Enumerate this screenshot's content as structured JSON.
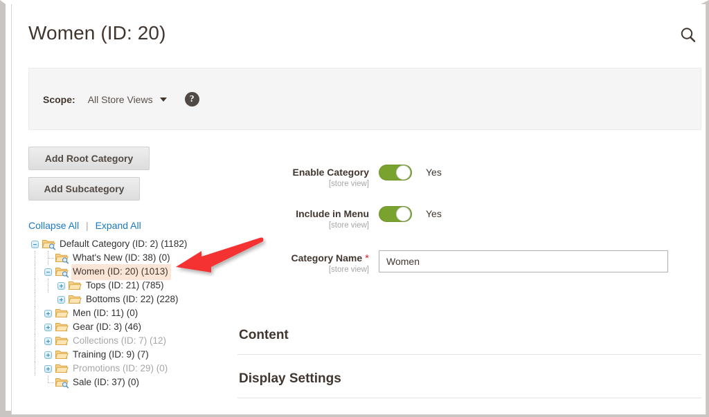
{
  "header": {
    "title": "Women (ID: 20)",
    "search_icon": "search-icon"
  },
  "scope": {
    "label": "Scope:",
    "value": "All Store Views",
    "help_glyph": "?",
    "caret_icon": "chevron-down-icon"
  },
  "tree_actions": {
    "add_root_category": "Add Root Category",
    "add_subcategory": "Add Subcategory",
    "collapse_all": "Collapse All",
    "separator": "|",
    "expand_all": "Expand All"
  },
  "tree": {
    "nodes": [
      {
        "label": "Default Category (ID: 2) (1182)",
        "depth": 0,
        "state": "expanded",
        "icon": "folder-open-search-icon",
        "selected": false,
        "disabled": false,
        "last": false
      },
      {
        "label": "What's New (ID: 38) (0)",
        "depth": 1,
        "state": "leaf",
        "icon": "folder-open-search-icon",
        "selected": false,
        "disabled": false,
        "last": false
      },
      {
        "label": "Women (ID: 20) (1013)",
        "depth": 1,
        "state": "expanded",
        "icon": "folder-open-search-icon",
        "selected": true,
        "disabled": false,
        "last": false
      },
      {
        "label": "Tops (ID: 21) (785)",
        "depth": 2,
        "state": "collapsed",
        "icon": "folder-icon",
        "selected": false,
        "disabled": false,
        "last": false
      },
      {
        "label": "Bottoms (ID: 22) (228)",
        "depth": 2,
        "state": "collapsed",
        "icon": "folder-icon",
        "selected": false,
        "disabled": false,
        "last": true
      },
      {
        "label": "Men (ID: 11) (0)",
        "depth": 1,
        "state": "collapsed",
        "icon": "folder-icon",
        "selected": false,
        "disabled": false,
        "last": false
      },
      {
        "label": "Gear (ID: 3) (46)",
        "depth": 1,
        "state": "collapsed",
        "icon": "folder-icon",
        "selected": false,
        "disabled": false,
        "last": false
      },
      {
        "label": "Collections (ID: 7) (12)",
        "depth": 1,
        "state": "collapsed",
        "icon": "folder-icon",
        "selected": false,
        "disabled": true,
        "last": false
      },
      {
        "label": "Training (ID: 9) (7)",
        "depth": 1,
        "state": "collapsed",
        "icon": "folder-icon",
        "selected": false,
        "disabled": false,
        "last": false
      },
      {
        "label": "Promotions (ID: 29) (0)",
        "depth": 1,
        "state": "collapsed",
        "icon": "folder-icon",
        "selected": false,
        "disabled": true,
        "last": false
      },
      {
        "label": "Sale (ID: 37) (0)",
        "depth": 1,
        "state": "leaf",
        "icon": "folder-open-search-icon",
        "selected": false,
        "disabled": false,
        "last": true
      }
    ]
  },
  "form": {
    "enable_category": {
      "label": "Enable Category",
      "scope": "[store view]",
      "toggle_state": "Yes",
      "required": false
    },
    "include_in_menu": {
      "label": "Include in Menu",
      "scope": "[store view]",
      "toggle_state": "Yes",
      "required": false
    },
    "category_name": {
      "label": "Category Name",
      "scope": "[store view]",
      "required_marker": "*",
      "value": "Women",
      "placeholder": ""
    }
  },
  "sections": [
    {
      "title": "Content"
    },
    {
      "title": "Display Settings"
    }
  ],
  "colors": {
    "accent_link": "#1979c3",
    "toggle_on": "#79a22e",
    "selected_row": "#fae5d7",
    "required_star": "#e22626",
    "help_badge": "#514943",
    "annotation_arrow": "#f53232"
  }
}
